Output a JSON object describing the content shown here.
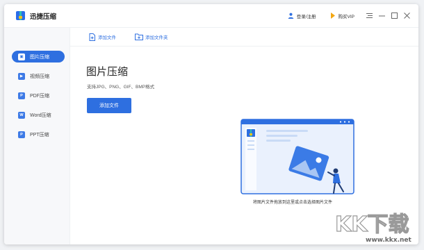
{
  "app": {
    "title": "迅捷压缩"
  },
  "titlebar": {
    "login_label": "登录/注册",
    "vip_label": "购买VIP",
    "icons": [
      "user-icon",
      "crown-icon",
      "menu-icon",
      "minimize-icon",
      "maximize-icon",
      "close-icon"
    ]
  },
  "sidebar": {
    "items": [
      {
        "label": "图片压缩",
        "active": true,
        "icon": "image-doc-icon"
      },
      {
        "label": "视频压缩",
        "active": false,
        "icon": "video-doc-icon"
      },
      {
        "label": "PDF压缩",
        "active": false,
        "icon": "pdf-doc-icon"
      },
      {
        "label": "Word压缩",
        "active": false,
        "icon": "word-doc-icon"
      },
      {
        "label": "PPT压缩",
        "active": false,
        "icon": "ppt-doc-icon"
      }
    ]
  },
  "toolbar": {
    "add_file_label": "添加文件",
    "add_folder_label": "添加文件夹"
  },
  "main": {
    "title": "图片压缩",
    "subtitle": "支持JPG、PNG、GIF、BMP格式",
    "add_button_label": "添加文件",
    "drop_hint": "将图片文件拖放到这里或点击选择图片文件"
  },
  "watermark": {
    "logo_text": "KK下载",
    "url": "www.kkx.net"
  },
  "colors": {
    "accent": "#2e6fe0",
    "illustration_bg": "#eaf1fd",
    "accent_light": "#a9c6f3"
  }
}
